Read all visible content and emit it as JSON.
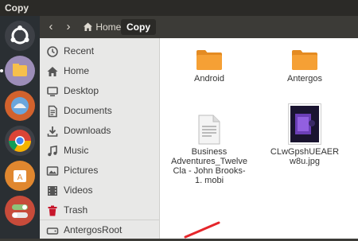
{
  "window": {
    "title": "Copy"
  },
  "header": {
    "back_glyph": "‹",
    "forward_glyph": "›",
    "breadcrumbs": [
      {
        "label": "Home",
        "icon": "home-icon"
      },
      {
        "label": "Copy"
      }
    ]
  },
  "sidebar": {
    "items": [
      {
        "label": "Recent",
        "icon": "clock-icon"
      },
      {
        "label": "Home",
        "icon": "home-icon"
      },
      {
        "label": "Desktop",
        "icon": "desktop-icon"
      },
      {
        "label": "Documents",
        "icon": "document-icon"
      },
      {
        "label": "Downloads",
        "icon": "download-icon"
      },
      {
        "label": "Music",
        "icon": "music-icon"
      },
      {
        "label": "Pictures",
        "icon": "pictures-icon"
      },
      {
        "label": "Videos",
        "icon": "videos-icon"
      },
      {
        "label": "Trash",
        "icon": "trash-icon"
      },
      {
        "label": "AntergosRoot",
        "icon": "drive-icon"
      }
    ]
  },
  "files": [
    {
      "name": "Android",
      "type": "folder"
    },
    {
      "name": "Antergos",
      "type": "folder"
    },
    {
      "name": "Business Adventures_Twelve Cla - John Brooks-1. mobi",
      "type": "document"
    },
    {
      "name": "CLwGpshUEAER w8u.jpg",
      "type": "image"
    }
  ],
  "colors": {
    "folder": "#f5a035",
    "accent": "#e95420",
    "launcher_bg": "#2a2f33"
  }
}
